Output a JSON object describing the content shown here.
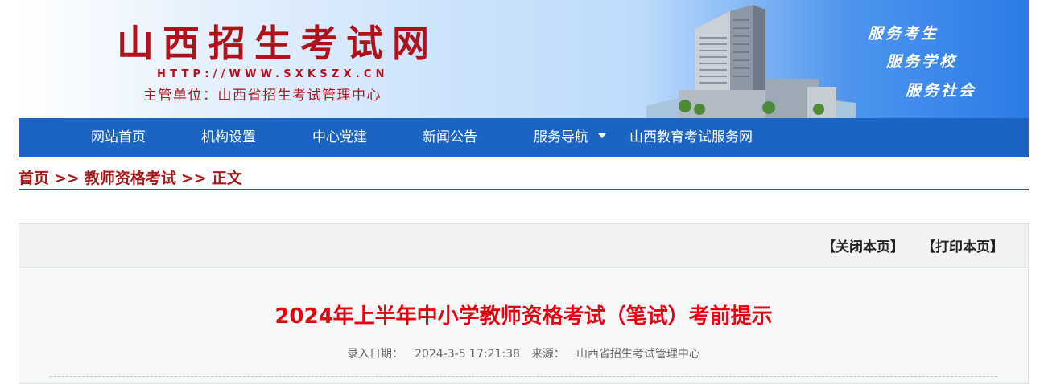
{
  "header": {
    "site_title": "山西招生考试网",
    "site_url": "HTTP://WWW.SXKSZX.CN",
    "org": "主管单位：山西省招生考试管理中心",
    "slogans": [
      "服务考生",
      "服务学校",
      "服务社会"
    ],
    "title_color": "#b0121b"
  },
  "nav": {
    "items": [
      "网站首页",
      "机构设置",
      "中心党建",
      "新闻公告",
      "服务导航",
      "山西教育考试服务网"
    ],
    "bg_color": "#1b64c4"
  },
  "breadcrumb": {
    "home": "首页",
    "section": "教师资格考试",
    "current": "正文",
    "separator": ">>"
  },
  "article": {
    "close_label": "【关闭本页】",
    "print_label": "【打印本页】",
    "title": "2024年上半年中小学教师资格考试（笔试）考前提示",
    "date_label": "录入日期：",
    "date_value": "2024-3-5 17:21:38",
    "source_label": "来源：",
    "source_value": "山西省招生考试管理中心",
    "title_color": "#e60012"
  }
}
